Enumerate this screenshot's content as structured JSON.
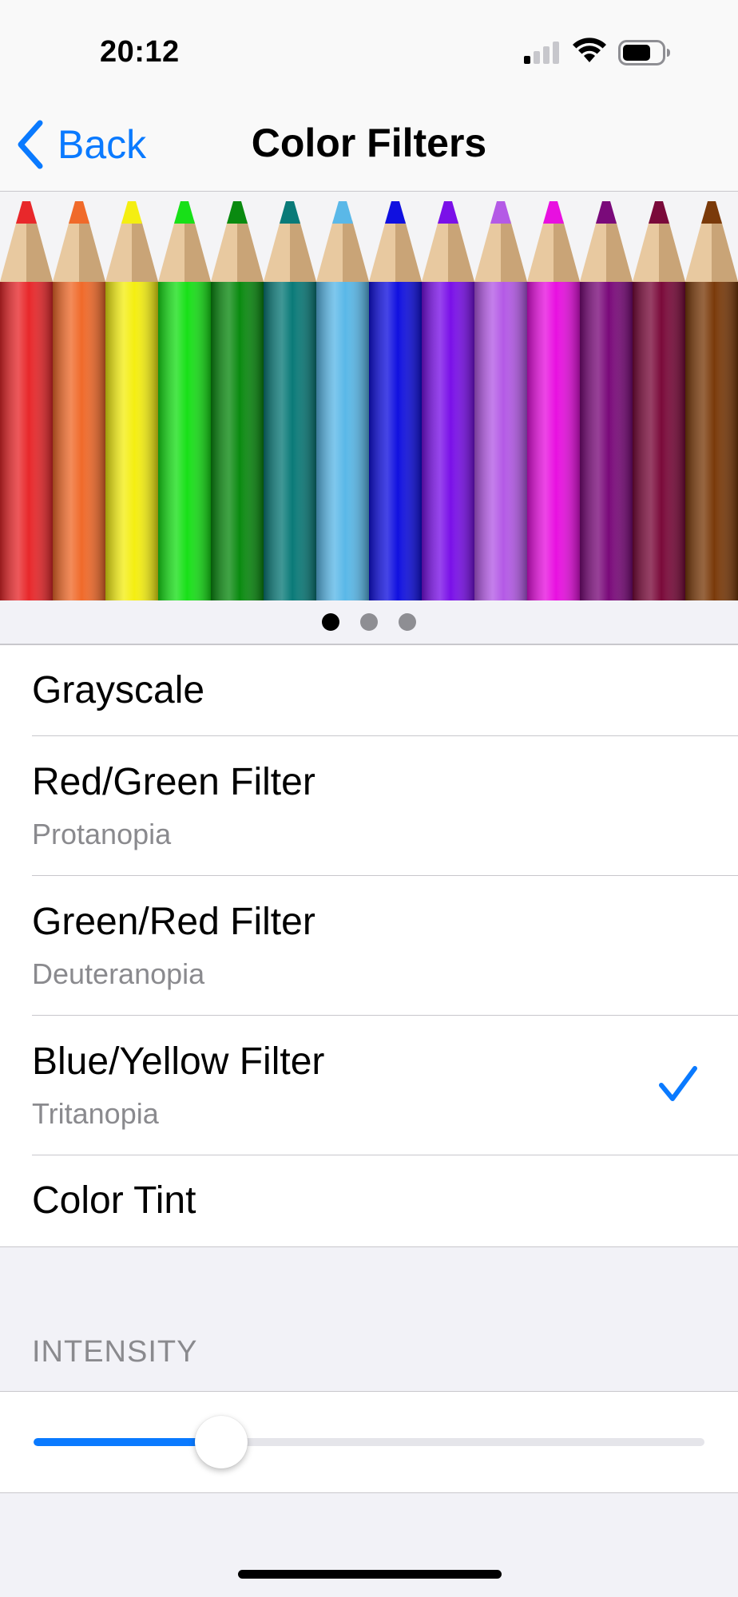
{
  "status_bar": {
    "time": "20:12"
  },
  "nav": {
    "back_label": "Back",
    "title": "Color Filters"
  },
  "carousel": {
    "pages": 3,
    "current_page": 1,
    "pencil_colors": [
      "#e8282b",
      "#f06a2a",
      "#f4ee12",
      "#18e018",
      "#0a8a10",
      "#0a7a78",
      "#5ab8e8",
      "#1010e0",
      "#7a10e8",
      "#b45ae6",
      "#e810e0",
      "#7a0a7a",
      "#7a0a3a",
      "#7a3a0a"
    ]
  },
  "filters": [
    {
      "label": "Grayscale",
      "subtitle": "",
      "selected": false
    },
    {
      "label": "Red/Green Filter",
      "subtitle": "Protanopia",
      "selected": false
    },
    {
      "label": "Green/Red Filter",
      "subtitle": "Deuteranopia",
      "selected": false
    },
    {
      "label": "Blue/Yellow Filter",
      "subtitle": "Tritanopia",
      "selected": true
    },
    {
      "label": "Color Tint",
      "subtitle": "",
      "selected": false
    }
  ],
  "intensity": {
    "header": "INTENSITY",
    "value": 0.28
  },
  "colors": {
    "accent": "#0a7aff",
    "secondary_text": "#8a8a8e"
  }
}
